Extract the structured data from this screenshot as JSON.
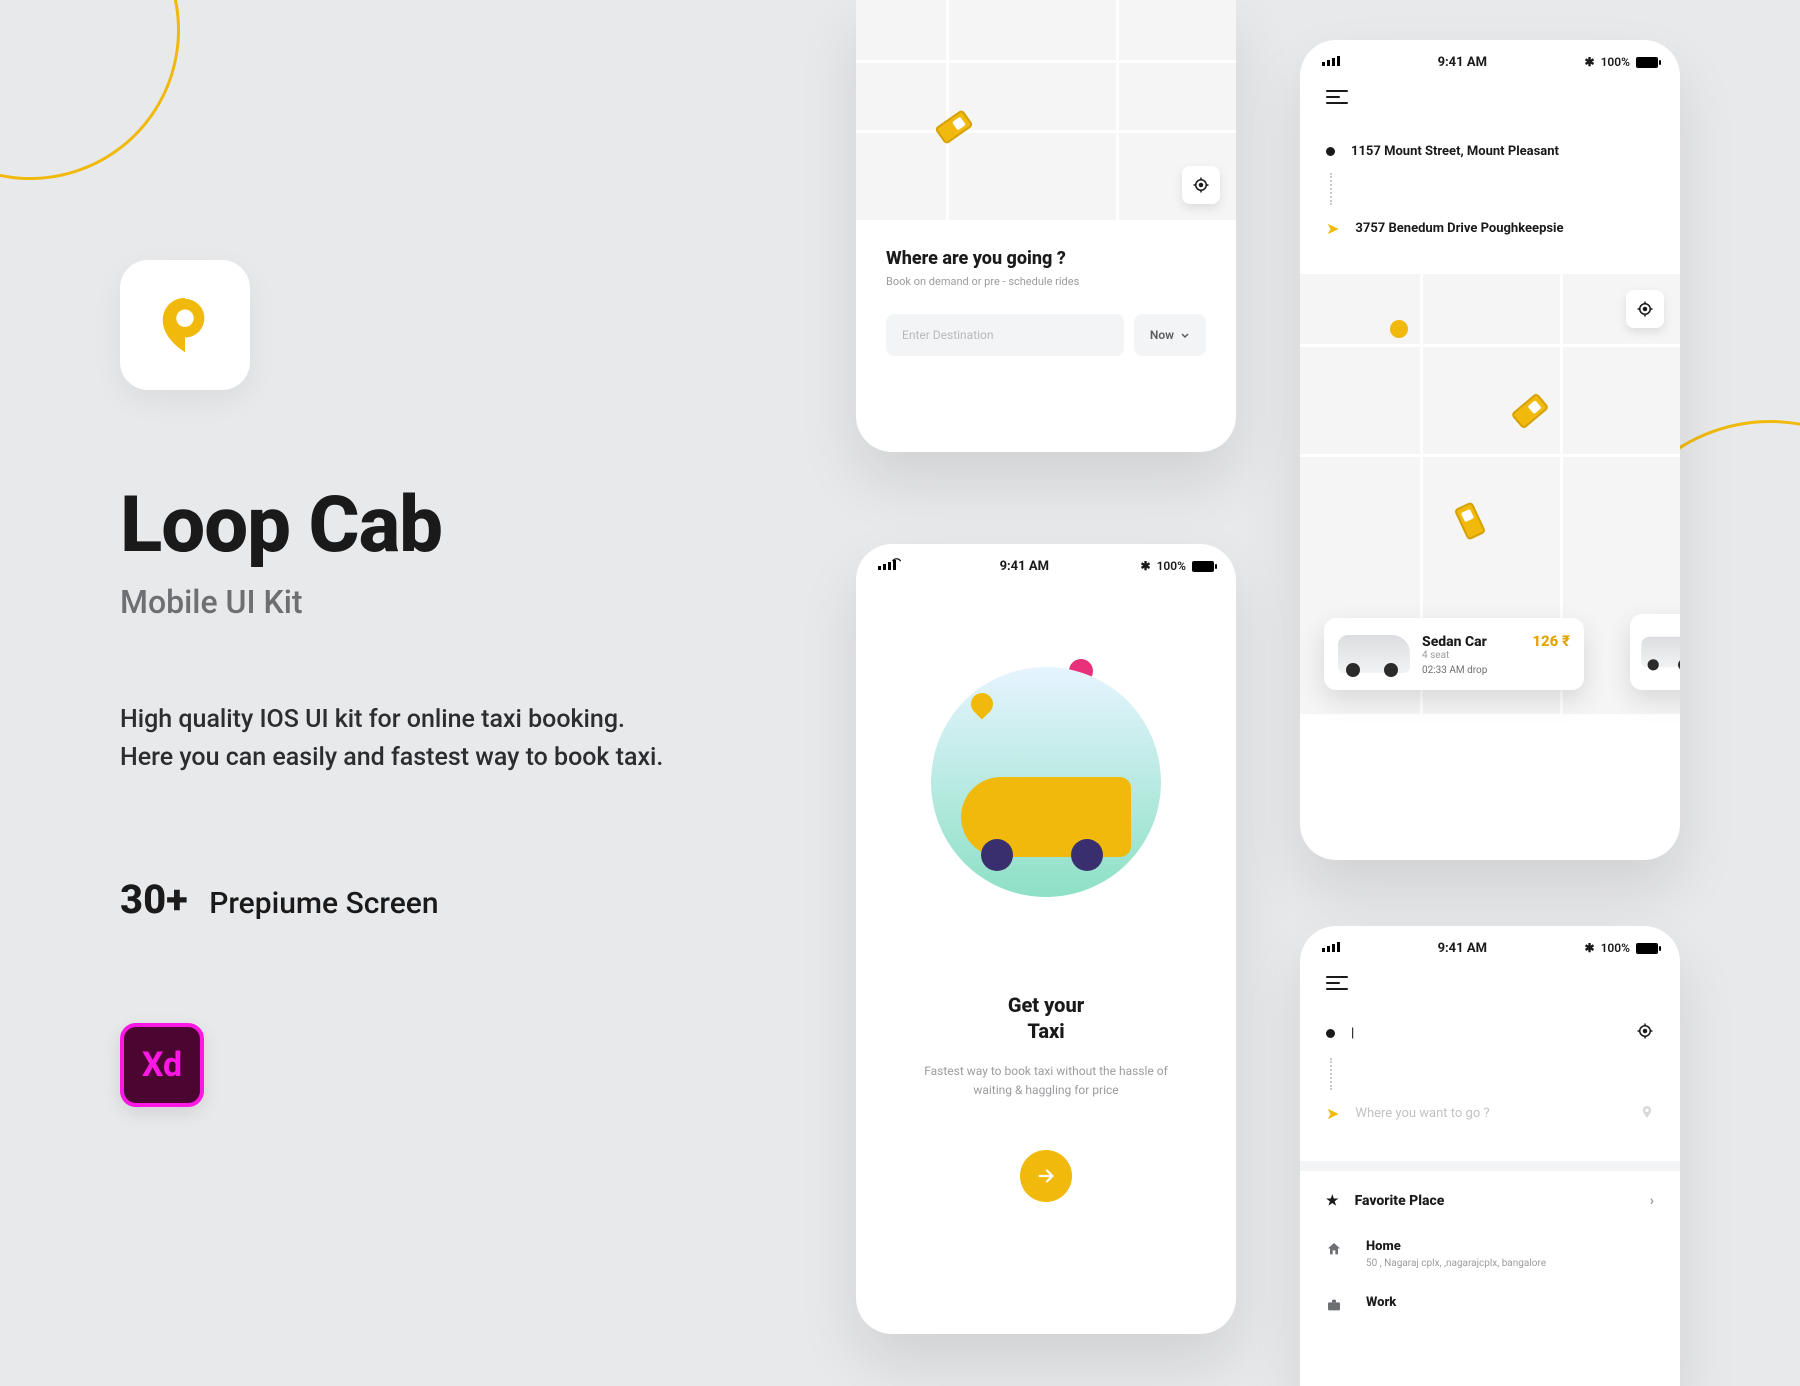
{
  "hero": {
    "title": "Loop Cab",
    "subtitle": "Mobile UI Kit",
    "description_line1": "High quality IOS UI kit for online taxi booking.",
    "description_line2": "Here you can easily and fastest way to book taxi.",
    "screen_count": "30+",
    "screen_count_label": "Prepiume Screen",
    "xd_label": "Xd"
  },
  "statusbar": {
    "time": "9:41 AM",
    "battery": "100%"
  },
  "phoneA": {
    "title": "Where are you going  ?",
    "subtitle": "Book on demand or pre - schedule rides",
    "placeholder": "Enter Destination",
    "now_label": "Now"
  },
  "phoneB": {
    "title_line1": "Get your",
    "title_line2": "Taxi",
    "subtitle": "Fastest way to book taxi without the hassle of waiting & haggling for price"
  },
  "phoneC": {
    "pickup": "1157 Mount Street, Mount Pleasant",
    "dropoff": "3757 Benedum Drive Poughkeepsie",
    "car": {
      "name": "Sedan Car",
      "seat": "4 seat",
      "drop": "02:33 AM drop",
      "price": "126 ₹"
    }
  },
  "phoneD": {
    "current_placeholder": "|",
    "destination_placeholder": "Where you want to go ?",
    "favorite_label": "Favorite Place",
    "places": [
      {
        "name": "Home",
        "addr": "50 , Nagaraj cplx, ,nagarajcplx, bangalore"
      },
      {
        "name": "Work",
        "addr": ""
      }
    ]
  }
}
